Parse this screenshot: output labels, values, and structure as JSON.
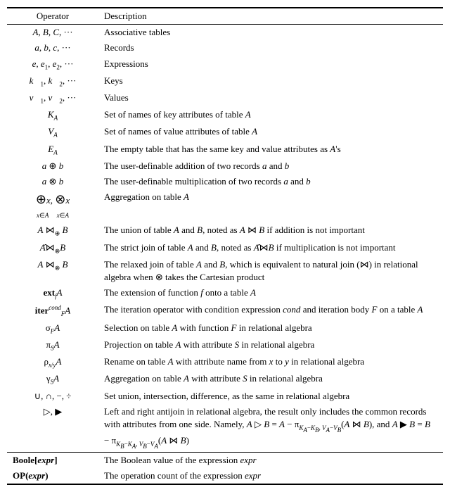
{
  "table": {
    "headers": [
      "Operator",
      "Description"
    ],
    "rows": [
      {
        "operator_html": "<i>A</i>, <i>B</i>, <i>C</i>, &middot;&middot;&middot;",
        "description": "Associative tables"
      },
      {
        "operator_html": "<i>a</i>, <i>b</i>, <i>c</i>, &middot;&middot;&middot;",
        "description": "Records"
      },
      {
        "operator_html": "<i>e</i>, <i>e</i><sub>1</sub>, <i>e</i><sub>2</sub>, &middot;&middot;&middot;",
        "description": "Expressions"
      },
      {
        "operator_html": "<i>k&#x20D7;</i><sub>1</sub>, <i>k&#x20D7;</i><sub>2</sub>, &middot;&middot;&middot;",
        "description": "Keys"
      },
      {
        "operator_html": "<i>v&#x20D7;</i><sub>1</sub>, <i>v&#x20D7;</i><sub>2</sub>, &middot;&middot;&middot;",
        "description": "Values"
      },
      {
        "operator_html": "<i>K<sub>A</sub></i>",
        "description": "Set of names of key attributes of table <i>A</i>"
      },
      {
        "operator_html": "<i>V<sub>A</sub></i>",
        "description": "Set of names of value attributes of table <i>A</i>"
      },
      {
        "operator_html": "<i>E<sub>A</sub></i>",
        "description": "The empty table that has the same key and value attributes as <i>A</i>'s"
      },
      {
        "operator_html": "<i>a</i> &oplus; <i>b</i>",
        "description": "The user-definable addition of two records <i>a</i> and <i>b</i>"
      },
      {
        "operator_html": "<i>a</i> &otimes; <i>b</i>",
        "description": "The user-definable multiplication of two records <i>a</i> and <i>b</i>"
      },
      {
        "operator_html": "<span style='font-size:18px'>&oplus;</span><i>x</i>, <span style='font-size:18px'>&otimes;</span><i>x</i><br><span style='font-size:9px'><i>x</i>&isin;<i>A</i> &nbsp;&nbsp;&nbsp; <i>x</i>&isin;<i>A</i></span>",
        "description": "Aggregation on table <i>A</i>"
      },
      {
        "operator_html": "<i>A</i> &#8904;<sub>&oplus;</sub> <i>B</i>",
        "description": "The union of table <i>A</i> and <i>B</i>, noted as <i>A</i> &#8904; <i>B</i> if addition is not important"
      },
      {
        "operator_html": "<i>A</i>&#770;&#8904;<sub>&otimes;</sub><i>B</i>",
        "description": "The strict join of table <i>A</i> and <i>B</i>, noted as <i>A</i>&#770;&#8904;<i>B</i> if multiplication is not important",
        "multiline": true
      },
      {
        "operator_html": "<i>A</i> &#8904;<sub>&otimes;</sub> <i>B</i>",
        "description": "The relaxed join of table <i>A</i> and <i>B</i>, which is equivalent to natural join (&#8904;) in relational algebra when &otimes; takes the Cartesian product",
        "multiline": true
      },
      {
        "operator_html": "<b>ext</b><sub><i>f</i></sub><i>A</i>",
        "description": "The extension of function <i>f</i> onto a table <i>A</i>"
      },
      {
        "operator_html": "<b>iter</b><sup><i>cond</i></sup><sub><i>F</i></sub><i>A</i>",
        "description": "The iteration operator with condition expression <i>cond</i> and iteration body <i>F</i> on a table <i>A</i>",
        "multiline": true
      },
      {
        "operator_html": "&sigma;<sub><i>F</i></sub><i>A</i>",
        "description": "Selection on table <i>A</i> with function <i>F</i> in relational algebra"
      },
      {
        "operator_html": "&pi;<sub><i>S</i></sub><i>A</i>",
        "description": "Projection on table <i>A</i> with attribute <i>S</i> in relational algebra"
      },
      {
        "operator_html": "&rho;<sub><i>x</i>/<i>y</i></sub><i>A</i>",
        "description": "Rename on table <i>A</i> with attribute name from <i>x</i> to <i>y</i> in relational algebra"
      },
      {
        "operator_html": "&gamma;<sub><i>S</i></sub><i>A</i>",
        "description": "Aggregation on table <i>A</i> with attribute <i>S</i> in relational algebra"
      },
      {
        "operator_html": "&cup;, &cap;, &minus;, &divide;",
        "description": "Set union, intersection, difference, as the same in relational algebra"
      },
      {
        "operator_html": "&#9655;, &#9654;",
        "description": "Left and right antijoin in relational algebra, the result only includes the common records with attributes from one side. Namely, <i>A</i> &#9655; <i>B</i> = <i>A</i> &minus; &pi;<sub><i>K<sub>A</sub></i>&minus;<i>K<sub>B</sub></i>, <i>V<sub>A</sub></i>&minus;<i>V<sub>B</sub></i></sub>(<i>A</i> &#8904; <i>B</i>), and <i>A</i> &#9654; <i>B</i> = <i>B</i> &minus; &pi;<sub><i>K<sub>B</sub></i>&minus;<i>K<sub>A</sub></i>, <i>V<sub>B</sub></i>&minus;<i>V<sub>A</sub></i></sub>(<i>A</i> &#8904; <i>B</i>)",
        "multiline": true
      },
      {
        "operator_html": "Boole[<i>expr</i>]",
        "description": "The Boolean value of the expression <i>expr</i>",
        "left_align": true
      },
      {
        "operator_html": "<b>OP</b>(<i>expr</i>)",
        "description": "The operation count of the expression <i>expr</i>",
        "left_align": true
      }
    ]
  }
}
